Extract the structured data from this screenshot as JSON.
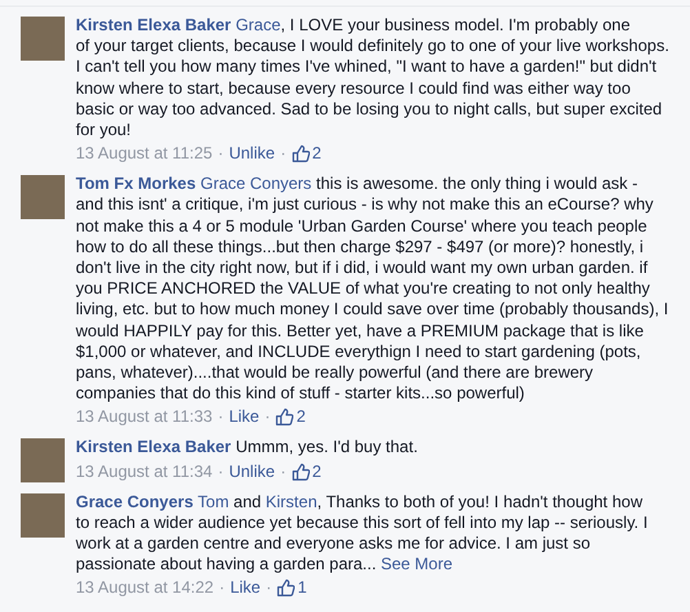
{
  "comments": [
    {
      "author": "Kirsten Elexa Baker",
      "body": [
        {
          "kind": "mention",
          "text": "Grace"
        },
        {
          "kind": "text",
          "text": ", I LOVE your business model. I'm probably one of your target clients, because I would definitely go to one of your live workshops. I can't tell you how many times I've whined, \"I want to have a garden!\" but didn't know where to start, because every resource I could find was either way too basic or way too advanced. Sad to be losing you to night calls, but super excited for you!"
        }
      ],
      "time": "13 August at 11:25",
      "separators": [
        "·",
        "·"
      ],
      "action": "Unlike",
      "likes": "2"
    },
    {
      "author": "Tom Fx Morkes",
      "body": [
        {
          "kind": "mention",
          "text": "Grace Conyers"
        },
        {
          "kind": "text",
          "text": " this is awesome. the only thing i would ask - and this isnt' a critique, i'm just curious - is why not make this an eCourse? why not make this a 4 or 5 module 'Urban Garden Course' where you teach people how to do all these things...but then charge $297 - $497 (or more)? honestly, i don't live in the city right now, but if i did, i would want my own urban garden. if you PRICE ANCHORED the VALUE of what you're creating to not only healthy living, etc. but to how much money I could save over time (probably thousands), I would HAPPILY pay for this. Better yet, have a PREMIUM package that is like $1,000 or whatever, and INCLUDE everythign I need to start gardening (pots, pans, whatever)....that would be really powerful (and there are brewery companies that do this kind of stuff - starter kits...so powerful)"
        }
      ],
      "time": "13 August at 11:33",
      "separators": [
        "·",
        "·"
      ],
      "action": "Like",
      "likes": "2"
    },
    {
      "author": "Kirsten Elexa Baker",
      "body": [
        {
          "kind": "text",
          "text": " Ummm, yes. I'd buy that."
        }
      ],
      "time": "13 August at 11:34",
      "separators": [
        "·",
        "·"
      ],
      "action": "Unlike",
      "likes": "2"
    },
    {
      "author": "Grace Conyers",
      "body": [
        {
          "kind": "mention",
          "text": "Tom"
        },
        {
          "kind": "text",
          "text": " and "
        },
        {
          "kind": "mention",
          "text": "Kirsten"
        },
        {
          "kind": "text",
          "text": ", Thanks to both of you! I hadn't thought how to reach a wider audience yet because this sort of fell into my lap -- seriously. I work at a garden centre and everyone asks me for advice. I am just so passionate about having a garden para... "
        },
        {
          "kind": "more",
          "text": "See More"
        }
      ],
      "time": "13 August at 14:22",
      "separators": [
        "·",
        "·"
      ],
      "action": "Like",
      "likes": "1"
    }
  ]
}
